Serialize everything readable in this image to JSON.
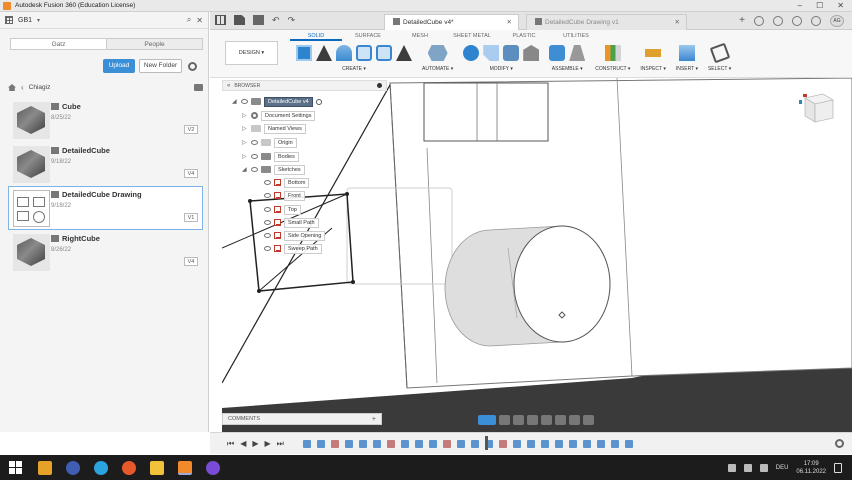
{
  "window": {
    "title": "Autodesk Fusion 360 (Education License)"
  },
  "data_panel": {
    "team": "GB1",
    "tabs": [
      "Gatz",
      "People"
    ],
    "upload_label": "Upload",
    "new_folder_label": "New Folder",
    "breadcrumb": "Chiagiz",
    "files": [
      {
        "name": "Cube",
        "date": "8/25/22",
        "version": "V2"
      },
      {
        "name": "DetailedCube",
        "date": "9/18/22",
        "version": "V4"
      },
      {
        "name": "DetailedCube Drawing",
        "date": "9/18/22",
        "version": "V1"
      },
      {
        "name": "RightCube",
        "date": "8/26/22",
        "version": "V4"
      }
    ]
  },
  "doc_tabs": [
    {
      "label": "DetailedCube v4*"
    },
    {
      "label": "DetailedCube Drawing v1"
    }
  ],
  "user_initials": "AG",
  "toolbar": {
    "design_label": "DESIGN ▾",
    "ribbon_tabs": [
      "SOLID",
      "SURFACE",
      "MESH",
      "SHEET METAL",
      "PLASTIC",
      "UTILITIES"
    ],
    "groups": [
      "CREATE ▾",
      "AUTOMATE ▾",
      "MODIFY ▾",
      "ASSEMBLE ▾",
      "CONSTRUCT ▾",
      "INSPECT ▾",
      "INSERT ▾",
      "SELECT ▾"
    ]
  },
  "browser": {
    "header": "BROWSER",
    "root": "DetailedCube v4",
    "nodes": [
      "Document Settings",
      "Named Views",
      "Origin",
      "Bodies",
      "Sketches"
    ],
    "sketches": [
      "Bottom",
      "Front",
      "Top",
      "Small Path",
      "Side Opening",
      "Sweep Path"
    ]
  },
  "comments_label": "COMMENTS",
  "taskbar": {
    "lang": "DEU",
    "time": "17:09",
    "date": "06.11.2022"
  },
  "colors": {
    "accent": "#0b6cbf",
    "upload": "#3b8fd6",
    "taskbar": "#1c1c1c"
  }
}
